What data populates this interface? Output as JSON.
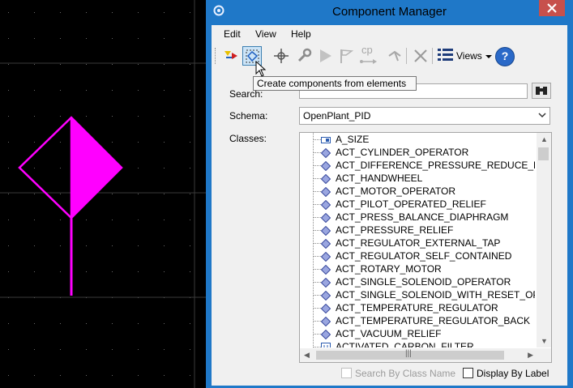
{
  "window": {
    "title": "Component Manager",
    "close_symbol": "✕"
  },
  "menu": [
    "Edit",
    "View",
    "Help"
  ],
  "toolbar": {
    "cp_label": "cp",
    "views_label": "Views",
    "help_label": "?"
  },
  "tooltip": "Create components from elements",
  "search": {
    "label": "Search:",
    "value": ""
  },
  "schema": {
    "label": "Schema:",
    "value": "OpenPlant_PID"
  },
  "classes": {
    "label": "Classes:",
    "items": [
      "A_SIZE",
      "ACT_CYLINDER_OPERATOR",
      "ACT_DIFFERENCE_PRESSURE_REDUCE_REGU",
      "ACT_HANDWHEEL",
      "ACT_MOTOR_OPERATOR",
      "ACT_PILOT_OPERATED_RELIEF",
      "ACT_PRESS_BALANCE_DIAPHRAGM",
      "ACT_PRESSURE_RELIEF",
      "ACT_REGULATOR_EXTERNAL_TAP",
      "ACT_REGULATOR_SELF_CONTAINED",
      "ACT_ROTARY_MOTOR",
      "ACT_SINGLE_SOLENOID_OPERATOR",
      "ACT_SINGLE_SOLENOID_WITH_RESET_OPERA",
      "ACT_TEMPERATURE_REGULATOR",
      "ACT_TEMPERATURE_REGULATOR_BACK",
      "ACT_VACUUM_RELIEF",
      "ACTIVATED_CARBON_FILTER"
    ]
  },
  "options": {
    "search_by_class": "Search By Class Name",
    "display_by_label": "Display By Label"
  },
  "colors": {
    "symbol": "#ff00ff",
    "window_frame": "#1f78c8"
  }
}
